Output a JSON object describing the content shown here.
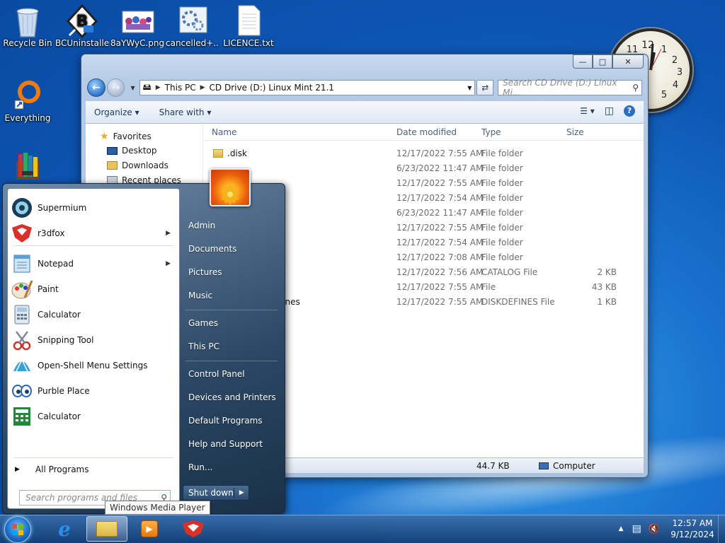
{
  "desktop": {
    "icons": [
      {
        "label": "Recycle Bin",
        "icon": "recycle-bin-icon"
      },
      {
        "label": "BCUninstaller",
        "icon": "bcuninstaller-icon"
      },
      {
        "label": "8aYWyC.png",
        "icon": "image-file-icon"
      },
      {
        "label": "cancelled+...",
        "icon": "settings-file-icon"
      },
      {
        "label": "LICENCE.txt",
        "icon": "text-file-icon"
      },
      {
        "label": "Everything",
        "icon": "everything-search-icon"
      }
    ],
    "clock_numbers": [
      "12",
      "1",
      "2",
      "3",
      "4",
      "5",
      "11"
    ]
  },
  "explorer": {
    "breadcrumb": [
      "This PC",
      "CD Drive (D:) Linux Mint 21.1"
    ],
    "search_placeholder": "Search CD Drive (D:) Linux Mi...",
    "toolbar": {
      "organize": "Organize",
      "share_with": "Share with"
    },
    "nav_pane": {
      "favorites": "Favorites",
      "items": [
        "Desktop",
        "Downloads",
        "Recent places"
      ]
    },
    "columns": {
      "name": "Name",
      "date": "Date modified",
      "type": "Type",
      "size": "Size"
    },
    "rows": [
      {
        "name": ".disk",
        "date": "12/17/2022 7:55 AM",
        "type": "File folder",
        "size": ""
      },
      {
        "name": "",
        "date": "6/23/2022 11:47 AM",
        "type": "File folder",
        "size": ""
      },
      {
        "name": "",
        "date": "12/17/2022 7:55 AM",
        "type": "File folder",
        "size": ""
      },
      {
        "name": "",
        "date": "12/17/2022 7:54 AM",
        "type": "File folder",
        "size": ""
      },
      {
        "name": "",
        "date": "6/23/2022 11:47 AM",
        "type": "File folder",
        "size": ""
      },
      {
        "name": "",
        "date": "12/17/2022 7:55 AM",
        "type": "File folder",
        "size": ""
      },
      {
        "name": "",
        "date": "12/17/2022 7:54 AM",
        "type": "File folder",
        "size": ""
      },
      {
        "name": "",
        "date": "12/17/2022 7:08 AM",
        "type": "File folder",
        "size": ""
      },
      {
        "name": "",
        "date": "12/17/2022 7:56 AM",
        "type": "CATALOG File",
        "size": "2 KB"
      },
      {
        "name": "",
        "date": "12/17/2022 7:55 AM",
        "type": "File",
        "size": "43 KB"
      },
      {
        "name": "fines",
        "date": "12/17/2022 7:55 AM",
        "type": "DISKDEFINES File",
        "size": "1 KB"
      }
    ],
    "status": {
      "size": "44.7 KB",
      "location": "Computer"
    }
  },
  "start_menu": {
    "programs": [
      {
        "label": "Supermium",
        "icon": "supermium-icon",
        "submenu": false
      },
      {
        "label": "r3dfox",
        "icon": "r3dfox-icon",
        "submenu": true
      },
      {
        "label": "Notepad",
        "icon": "notepad-icon",
        "submenu": true
      },
      {
        "label": "Paint",
        "icon": "paint-icon",
        "submenu": false
      },
      {
        "label": "Calculator",
        "icon": "calculator-icon",
        "submenu": false
      },
      {
        "label": "Snipping Tool",
        "icon": "snipping-tool-icon",
        "submenu": false
      },
      {
        "label": "Open-Shell Menu Settings",
        "icon": "open-shell-icon",
        "submenu": false
      },
      {
        "label": "Purble Place",
        "icon": "purble-place-icon",
        "submenu": false
      },
      {
        "label": "Calculator",
        "icon": "calculator-green-icon",
        "submenu": false
      }
    ],
    "all_programs": "All Programs",
    "search_placeholder": "Search programs and files",
    "right": [
      "Admin",
      "Documents",
      "Pictures",
      "Music",
      "Games",
      "This PC",
      "Control Panel",
      "Devices and Printers",
      "Default Programs",
      "Help and Support",
      "Run..."
    ],
    "shutdown": "Shut down",
    "tooltip": "Windows Media Player"
  },
  "taskbar": {
    "time": "12:57 AM",
    "date": "9/12/2024"
  }
}
